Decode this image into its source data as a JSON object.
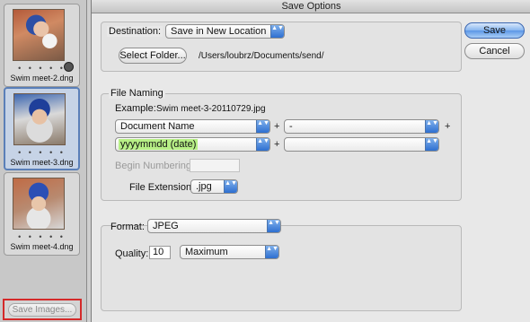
{
  "dialog_title": "Save Options",
  "filmstrip": {
    "items": [
      {
        "label": "Swim meet-2.dng",
        "dots": "• • • • •",
        "selected": false
      },
      {
        "label": "Swim meet-3.dng",
        "dots": "• • • • •",
        "selected": true
      },
      {
        "label": "Swim meet-4.dng",
        "dots": "• • • • •",
        "selected": false
      }
    ],
    "save_images_label": "Save Images..."
  },
  "destination": {
    "label": "Destination:",
    "popup_value": "Save in New Location",
    "select_folder_label": "Select Folder...",
    "path": "/Users/loubrz/Documents/send/"
  },
  "file_naming": {
    "legend": "File Naming",
    "example_label": "Example:",
    "example_value": "Swim meet-3-20110729.jpg",
    "row1": {
      "field1": "Document Name",
      "field2": "-"
    },
    "row2": {
      "field1": "yyyymmdd (date)",
      "field2": ""
    },
    "plus": "+",
    "begin_numbering_label": "Begin Numbering:",
    "begin_numbering_value": "",
    "file_extension_label": "File Extension:",
    "file_extension_value": ".jpg"
  },
  "format": {
    "label": "Format:",
    "value": "JPEG",
    "quality_label": "Quality:",
    "quality_value": "10",
    "quality_preset": "Maximum"
  },
  "buttons": {
    "save": "Save",
    "cancel": "Cancel"
  },
  "popup_arrows": "▲▼",
  "colors": {
    "highlight": "#b7ef86",
    "selected_border": "#5a7fb8",
    "red_outline": "#d42a2a"
  }
}
